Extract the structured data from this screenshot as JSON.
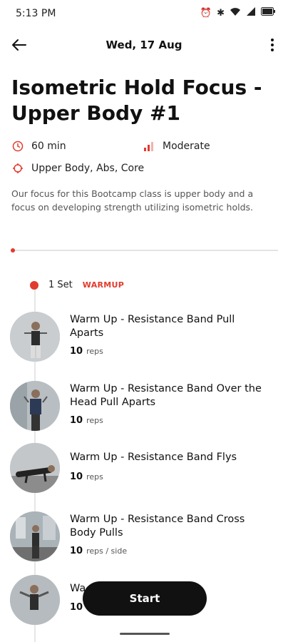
{
  "status": {
    "time": "5:13 PM"
  },
  "header": {
    "date": "Wed, 17 Aug"
  },
  "workout": {
    "title": "Isometric Hold Focus - Upper Body #1",
    "duration": "60 min",
    "intensity": "Moderate",
    "focus": "Upper Body, Abs, Core",
    "description": "Our focus for this Bootcamp class is upper body and a focus on developing strength utilizing isometric holds."
  },
  "set": {
    "count": "1 Set",
    "tag": "WARMUP"
  },
  "exercises": [
    {
      "name": "Warm Up - Resistance Band Pull Aparts",
      "reps": "10",
      "unit": "reps"
    },
    {
      "name": "Warm Up - Resistance Band Over the Head Pull Aparts",
      "reps": "10",
      "unit": "reps"
    },
    {
      "name": "Warm Up - Resistance Band Flys",
      "reps": "10",
      "unit": "reps"
    },
    {
      "name": "Warm Up - Resistance Band Cross Body Pulls",
      "reps": "10",
      "unit": "reps / side"
    },
    {
      "name": "Wa",
      "reps": "10",
      "unit": ""
    }
  ],
  "actions": {
    "start": "Start"
  },
  "colors": {
    "accent": "#e23b2e",
    "button": "#111111"
  }
}
